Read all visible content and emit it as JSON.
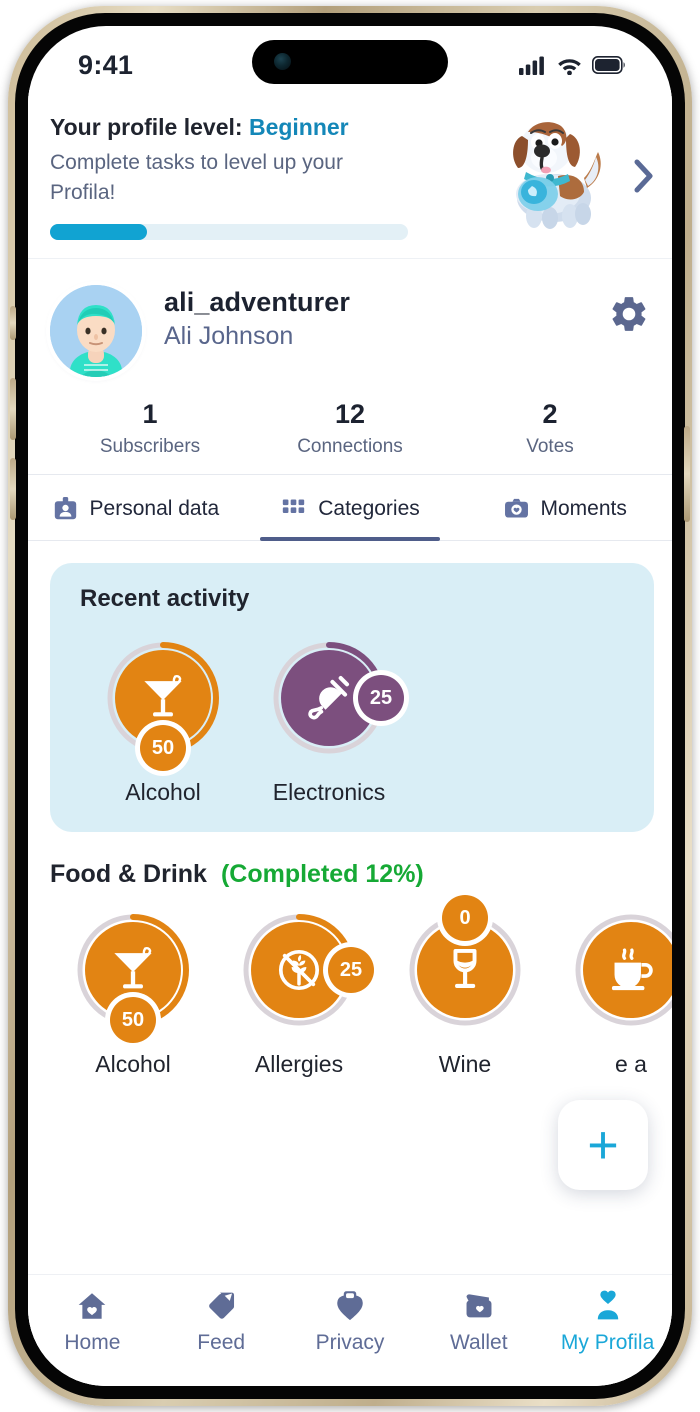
{
  "status_bar": {
    "time": "9:41",
    "icons": [
      "cellular-signal-icon",
      "wifi-icon",
      "battery-icon"
    ]
  },
  "level_banner": {
    "title_prefix": "Your profile level:",
    "level_name": "Beginner",
    "subtitle": "Complete tasks to level up your Profila!",
    "progress_percent": 27,
    "progress_color": "#11a3d2",
    "track_color": "#e3f0f6",
    "chevron": "chevron-right-icon",
    "illustration": "saint-bernard-dog-mascot"
  },
  "profile": {
    "username": "ali_adventurer",
    "full_name": "Ali Johnson",
    "avatar": "user-avatar",
    "settings_icon": "gear-icon",
    "stats": [
      {
        "value": "1",
        "label": "Subscribers"
      },
      {
        "value": "12",
        "label": "Connections"
      },
      {
        "value": "2",
        "label": "Votes"
      }
    ]
  },
  "tabs": [
    {
      "label": "Personal data",
      "icon": "id-card-icon",
      "active": false
    },
    {
      "label": "Categories",
      "icon": "grid-icon",
      "active": true
    },
    {
      "label": "Moments",
      "icon": "camera-icon",
      "active": false
    }
  ],
  "recent_activity": {
    "title": "Recent activity",
    "background": "#d9eef6",
    "items": [
      {
        "label": "Alcohol",
        "icon": "cocktail-glass-icon",
        "color": "#e28413",
        "badge": "50",
        "badge_position": "bottom",
        "arc_percent": 50
      },
      {
        "label": "Electronics",
        "icon": "power-plug-icon",
        "color": "#7c4f7e",
        "badge": "25",
        "badge_position": "right",
        "arc_percent": 25
      }
    ]
  },
  "food_and_drink": {
    "title": "Food & Drink",
    "completed_text": "(Completed 12%)",
    "completed_color": "#16a935",
    "items": [
      {
        "label": "Alcohol",
        "icon": "cocktail-glass-icon",
        "color": "#e28413",
        "badge": "50",
        "badge_position": "bottom",
        "arc_percent": 50
      },
      {
        "label": "Allergies",
        "icon": "wheat-allergy-icon",
        "color": "#e28413",
        "badge": "25",
        "badge_position": "right",
        "arc_percent": 25
      },
      {
        "label": "Wine",
        "icon": "wine-glass-icon",
        "color": "#e28413",
        "badge": "0",
        "badge_position": "top",
        "arc_percent": 0
      },
      {
        "label": "e a",
        "icon": "coffee-cup-icon",
        "color": "#e28413",
        "badge": "",
        "badge_position": "top",
        "arc_percent": 0
      }
    ]
  },
  "fab": {
    "icon": "plus-icon",
    "color": "#1aa7d8"
  },
  "bottom_nav": [
    {
      "label": "Home",
      "icon": "home-heart-icon",
      "active": false
    },
    {
      "label": "Feed",
      "icon": "tag-icon",
      "active": false
    },
    {
      "label": "Privacy",
      "icon": "lock-heart-icon",
      "active": false
    },
    {
      "label": "Wallet",
      "icon": "wallet-icon",
      "active": false
    },
    {
      "label": "My Profila",
      "icon": "person-heart-icon",
      "active": true
    }
  ]
}
